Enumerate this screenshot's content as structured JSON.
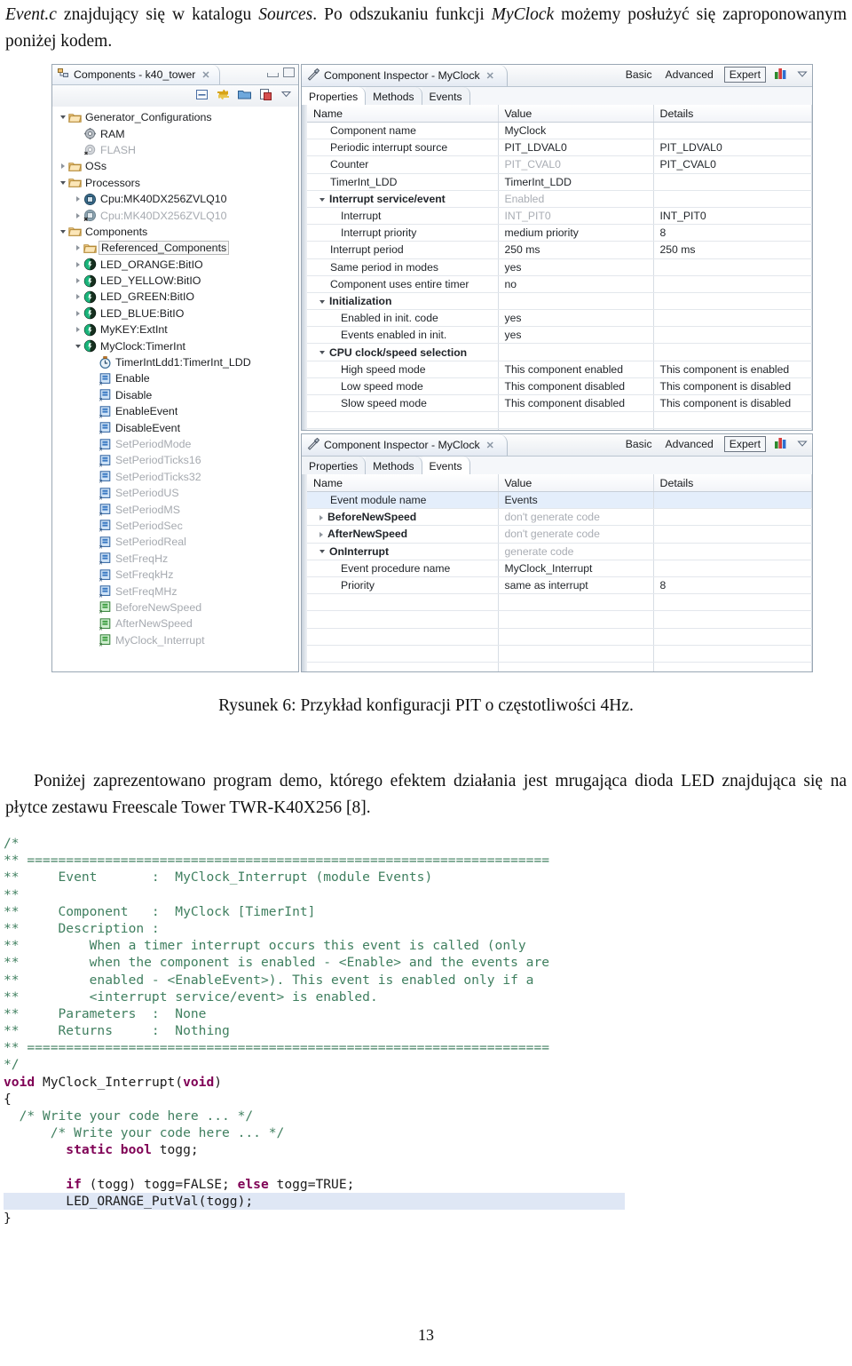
{
  "document": {
    "intro_paragraph": [
      {
        "t": "Event.c",
        "i": true
      },
      {
        "t": " znajdujący się w katalogu ",
        "i": false
      },
      {
        "t": "Sources",
        "i": true
      },
      {
        "t": ". Po odszukaniu funkcji ",
        "i": false
      },
      {
        "t": "MyClock",
        "i": true
      },
      {
        "t": " możemy posłużyć się zaproponowanym poniżej kodem.",
        "i": false
      }
    ],
    "figure_caption": "Rysunek 6: Przykład konfiguracji PIT o częstotliwości 4Hz.",
    "demo_paragraph": "Poniżej zaprezentowano program demo, którego efektem działania jest mrugająca dioda LED znajdująca się na płytce zestawu Freescale Tower TWR-K40X256 [8].",
    "page_number": "13"
  },
  "components_view": {
    "tab_title": "Components - k40_tower",
    "tab_icon": "components-icon",
    "close_label": "✕",
    "window_buttons": [
      "minimize",
      "maximize"
    ],
    "toolbar_icons": [
      "collapse-all-icon",
      "refresh-sync-icon",
      "folder-icon",
      "export-icon",
      "view-menu-chevron-icon"
    ],
    "tree": [
      {
        "label": "Generator_Configurations",
        "indent": 0,
        "arrow": "expanded",
        "icon": "folder-icon",
        "dim": false
      },
      {
        "label": "RAM",
        "indent": 1,
        "arrow": "none",
        "icon": "gear-icon",
        "dim": false
      },
      {
        "label": "FLASH",
        "indent": 1,
        "arrow": "none",
        "icon": "gear-disabled-icon",
        "dim": true
      },
      {
        "label": "OSs",
        "indent": 0,
        "arrow": "collapsed",
        "icon": "folder-icon",
        "dim": false
      },
      {
        "label": "Processors",
        "indent": 0,
        "arrow": "expanded",
        "icon": "folder-icon",
        "dim": false
      },
      {
        "label": "Cpu:MK40DX256ZVLQ10",
        "indent": 1,
        "arrow": "collapsed",
        "icon": "cpu-icon",
        "dim": false
      },
      {
        "label": "Cpu:MK40DX256ZVLQ10",
        "indent": 1,
        "arrow": "collapsed",
        "icon": "cpu-disabled-icon",
        "dim": true
      },
      {
        "label": "Components",
        "indent": 0,
        "arrow": "expanded",
        "icon": "folder-icon",
        "dim": false
      },
      {
        "label": "Referenced_Components",
        "indent": 1,
        "arrow": "collapsed",
        "icon": "folder-icon",
        "dim": false,
        "boxed": true
      },
      {
        "label": "LED_ORANGE:BitIO",
        "indent": 1,
        "arrow": "collapsed",
        "icon": "component-icon",
        "dim": false
      },
      {
        "label": "LED_YELLOW:BitIO",
        "indent": 1,
        "arrow": "collapsed",
        "icon": "component-icon",
        "dim": false
      },
      {
        "label": "LED_GREEN:BitIO",
        "indent": 1,
        "arrow": "collapsed",
        "icon": "component-icon",
        "dim": false
      },
      {
        "label": "LED_BLUE:BitIO",
        "indent": 1,
        "arrow": "collapsed",
        "icon": "component-icon",
        "dim": false
      },
      {
        "label": "MyKEY:ExtInt",
        "indent": 1,
        "arrow": "collapsed",
        "icon": "component-icon",
        "dim": false
      },
      {
        "label": "MyClock:TimerInt",
        "indent": 1,
        "arrow": "expanded",
        "icon": "component-icon",
        "dim": false
      },
      {
        "label": "TimerIntLdd1:TimerInt_LDD",
        "indent": 2,
        "arrow": "none",
        "icon": "timer-icon",
        "dim": false
      },
      {
        "label": "Enable",
        "indent": 2,
        "arrow": "none",
        "icon": "method-icon",
        "dim": false
      },
      {
        "label": "Disable",
        "indent": 2,
        "arrow": "none",
        "icon": "method-icon",
        "dim": false
      },
      {
        "label": "EnableEvent",
        "indent": 2,
        "arrow": "none",
        "icon": "method-icon",
        "dim": false
      },
      {
        "label": "DisableEvent",
        "indent": 2,
        "arrow": "none",
        "icon": "method-icon",
        "dim": false
      },
      {
        "label": "SetPeriodMode",
        "indent": 2,
        "arrow": "none",
        "icon": "method-icon",
        "dim": true
      },
      {
        "label": "SetPeriodTicks16",
        "indent": 2,
        "arrow": "none",
        "icon": "method-icon",
        "dim": true
      },
      {
        "label": "SetPeriodTicks32",
        "indent": 2,
        "arrow": "none",
        "icon": "method-icon",
        "dim": true
      },
      {
        "label": "SetPeriodUS",
        "indent": 2,
        "arrow": "none",
        "icon": "method-icon",
        "dim": true
      },
      {
        "label": "SetPeriodMS",
        "indent": 2,
        "arrow": "none",
        "icon": "method-icon",
        "dim": true
      },
      {
        "label": "SetPeriodSec",
        "indent": 2,
        "arrow": "none",
        "icon": "method-icon",
        "dim": true
      },
      {
        "label": "SetPeriodReal",
        "indent": 2,
        "arrow": "none",
        "icon": "method-icon",
        "dim": true
      },
      {
        "label": "SetFreqHz",
        "indent": 2,
        "arrow": "none",
        "icon": "method-icon",
        "dim": true
      },
      {
        "label": "SetFreqkHz",
        "indent": 2,
        "arrow": "none",
        "icon": "method-icon",
        "dim": true
      },
      {
        "label": "SetFreqMHz",
        "indent": 2,
        "arrow": "none",
        "icon": "method-icon",
        "dim": true
      },
      {
        "label": "BeforeNewSpeed",
        "indent": 2,
        "arrow": "none",
        "icon": "event-icon",
        "dim": true
      },
      {
        "label": "AfterNewSpeed",
        "indent": 2,
        "arrow": "none",
        "icon": "event-icon",
        "dim": true
      },
      {
        "label": "MyClock_Interrupt",
        "indent": 2,
        "arrow": "none",
        "icon": "event-icon",
        "dim": true
      }
    ]
  },
  "inspector_properties": {
    "tab_title": "Component Inspector - MyClock",
    "tab_icon": "inspector-icon",
    "close_label": "✕",
    "modes": [
      "Basic",
      "Advanced",
      "Expert"
    ],
    "active_mode": "Expert",
    "chart_icon": "bar-chart-icon",
    "menu_icon": "view-menu-chevron-icon",
    "sub_tabs": [
      "Properties",
      "Methods",
      "Events"
    ],
    "active_sub_tab": "Properties",
    "columns": [
      "Name",
      "Value",
      "Details"
    ],
    "rows": [
      {
        "name": "Component name",
        "level": 1,
        "group": false,
        "arrow": "none",
        "value": "MyClock",
        "value_gray": false,
        "details": ""
      },
      {
        "name": "Periodic interrupt source",
        "level": 1,
        "group": false,
        "arrow": "none",
        "value": "PIT_LDVAL0",
        "value_gray": false,
        "details": "PIT_LDVAL0"
      },
      {
        "name": "Counter",
        "level": 1,
        "group": false,
        "arrow": "none",
        "value": "PIT_CVAL0",
        "value_gray": true,
        "details": "PIT_CVAL0"
      },
      {
        "name": "TimerInt_LDD",
        "level": 1,
        "group": false,
        "arrow": "none",
        "value": "TimerInt_LDD",
        "value_gray": false,
        "details": ""
      },
      {
        "name": "Interrupt service/event",
        "level": 0,
        "group": true,
        "arrow": "expanded",
        "value": "Enabled",
        "value_gray": true,
        "details": ""
      },
      {
        "name": "Interrupt",
        "level": 2,
        "group": false,
        "arrow": "none",
        "value": "INT_PIT0",
        "value_gray": true,
        "details": "INT_PIT0"
      },
      {
        "name": "Interrupt priority",
        "level": 2,
        "group": false,
        "arrow": "none",
        "value": "medium priority",
        "value_gray": false,
        "details": "8"
      },
      {
        "name": "Interrupt period",
        "level": 1,
        "group": false,
        "arrow": "none",
        "value": "250 ms",
        "value_gray": false,
        "details": "250 ms"
      },
      {
        "name": "Same period in modes",
        "level": 1,
        "group": false,
        "arrow": "none",
        "value": "yes",
        "value_gray": false,
        "details": ""
      },
      {
        "name": "Component uses entire timer",
        "level": 1,
        "group": false,
        "arrow": "none",
        "value": "no",
        "value_gray": false,
        "details": ""
      },
      {
        "name": "Initialization",
        "level": 0,
        "group": true,
        "arrow": "expanded",
        "value": "",
        "value_gray": false,
        "details": ""
      },
      {
        "name": "Enabled in init. code",
        "level": 2,
        "group": false,
        "arrow": "none",
        "value": "yes",
        "value_gray": false,
        "details": ""
      },
      {
        "name": "Events enabled in init.",
        "level": 2,
        "group": false,
        "arrow": "none",
        "value": "yes",
        "value_gray": false,
        "details": ""
      },
      {
        "name": "CPU clock/speed selection",
        "level": 0,
        "group": true,
        "arrow": "expanded",
        "value": "",
        "value_gray": false,
        "details": ""
      },
      {
        "name": "High speed mode",
        "level": 2,
        "group": false,
        "arrow": "none",
        "value": "This component enabled",
        "value_gray": false,
        "details": "This component is enabled"
      },
      {
        "name": "Low speed mode",
        "level": 2,
        "group": false,
        "arrow": "none",
        "value": "This component disabled",
        "value_gray": false,
        "details": "This component is disabled"
      },
      {
        "name": "Slow speed mode",
        "level": 2,
        "group": false,
        "arrow": "none",
        "value": "This component disabled",
        "value_gray": false,
        "details": "This component is disabled"
      },
      {
        "name": "",
        "level": 1,
        "group": false,
        "arrow": "none",
        "value": "",
        "value_gray": false,
        "details": ""
      },
      {
        "name": "",
        "level": 1,
        "group": false,
        "arrow": "none",
        "value": "",
        "value_gray": false,
        "details": ""
      }
    ]
  },
  "inspector_events": {
    "tab_title": "Component Inspector - MyClock",
    "tab_icon": "inspector-icon",
    "close_label": "✕",
    "modes": [
      "Basic",
      "Advanced",
      "Expert"
    ],
    "active_mode": "Expert",
    "chart_icon": "bar-chart-icon",
    "menu_icon": "view-menu-chevron-icon",
    "sub_tabs": [
      "Properties",
      "Methods",
      "Events"
    ],
    "active_sub_tab": "Events",
    "columns": [
      "Name",
      "Value",
      "Details"
    ],
    "rows": [
      {
        "name": "Event module name",
        "level": 1,
        "group": false,
        "arrow": "none",
        "value": "Events",
        "value_gray": false,
        "details": "",
        "selected": true
      },
      {
        "name": "BeforeNewSpeed",
        "level": 0,
        "group": true,
        "arrow": "collapsed",
        "value": "don't generate code",
        "value_gray": true,
        "details": "",
        "selected": false
      },
      {
        "name": "AfterNewSpeed",
        "level": 0,
        "group": true,
        "arrow": "collapsed",
        "value": "don't generate code",
        "value_gray": true,
        "details": "",
        "selected": false
      },
      {
        "name": "OnInterrupt",
        "level": 0,
        "group": true,
        "arrow": "expanded",
        "value": "generate code",
        "value_gray": true,
        "details": "",
        "selected": false
      },
      {
        "name": "Event procedure name",
        "level": 2,
        "group": false,
        "arrow": "none",
        "value": "MyClock_Interrupt",
        "value_gray": false,
        "details": "",
        "selected": false
      },
      {
        "name": "Priority",
        "level": 2,
        "group": false,
        "arrow": "none",
        "value": "same as interrupt",
        "value_gray": false,
        "details": "8",
        "selected": false
      },
      {
        "name": "",
        "level": 1,
        "group": false,
        "arrow": "none",
        "value": "",
        "value_gray": false,
        "details": "",
        "selected": false
      },
      {
        "name": "",
        "level": 1,
        "group": false,
        "arrow": "none",
        "value": "",
        "value_gray": false,
        "details": "",
        "selected": false
      },
      {
        "name": "",
        "level": 1,
        "group": false,
        "arrow": "none",
        "value": "",
        "value_gray": false,
        "details": "",
        "selected": false
      },
      {
        "name": "",
        "level": 1,
        "group": false,
        "arrow": "none",
        "value": "",
        "value_gray": false,
        "details": "",
        "selected": false
      },
      {
        "name": "",
        "level": 1,
        "group": false,
        "arrow": "none",
        "value": "",
        "value_gray": false,
        "details": "",
        "selected": false
      }
    ]
  },
  "code_listing": {
    "language": "c",
    "lines": [
      [
        {
          "t": "/*",
          "c": "cm"
        }
      ],
      [
        {
          "t": "** ===================================================================",
          "c": "cm"
        }
      ],
      [
        {
          "t": "**     Event       :  MyClock_Interrupt (module Events)",
          "c": "cm"
        }
      ],
      [
        {
          "t": "**",
          "c": "cm"
        }
      ],
      [
        {
          "t": "**     Component   :  MyClock [TimerInt]",
          "c": "cm"
        }
      ],
      [
        {
          "t": "**     Description :",
          "c": "cm"
        }
      ],
      [
        {
          "t": "**         When a timer interrupt occurs this event is called (only",
          "c": "cm"
        }
      ],
      [
        {
          "t": "**         when the component is enabled - <Enable> and the events are",
          "c": "cm"
        }
      ],
      [
        {
          "t": "**         enabled - <EnableEvent>). This event is enabled only if a",
          "c": "cm"
        }
      ],
      [
        {
          "t": "**         <interrupt service/event> is enabled.",
          "c": "cm"
        }
      ],
      [
        {
          "t": "**     Parameters  :  None",
          "c": "cm"
        }
      ],
      [
        {
          "t": "**     Returns     :  Nothing",
          "c": "cm"
        }
      ],
      [
        {
          "t": "** ===================================================================",
          "c": "cm"
        }
      ],
      [
        {
          "t": "*/",
          "c": "cm"
        }
      ],
      [
        {
          "t": "void",
          "c": "kw"
        },
        {
          "t": " MyClock_Interrupt(",
          "c": "id"
        },
        {
          "t": "void",
          "c": "kw"
        },
        {
          "t": ")",
          "c": "id"
        }
      ],
      [
        {
          "t": "{",
          "c": "id"
        }
      ],
      [
        {
          "t": "  /* Write your code here ... */",
          "c": "cm"
        }
      ],
      [
        {
          "t": "      /* Write your code here ... */",
          "c": "cm"
        }
      ],
      [
        {
          "t": "        ",
          "c": "id"
        },
        {
          "t": "static bool",
          "c": "kw"
        },
        {
          "t": " togg;",
          "c": "id"
        }
      ],
      [
        {
          "t": "",
          "c": "id"
        }
      ],
      [
        {
          "t": "        ",
          "c": "id"
        },
        {
          "t": "if",
          "c": "kw"
        },
        {
          "t": " (togg) togg=FALSE; ",
          "c": "id"
        },
        {
          "t": "else",
          "c": "kw"
        },
        {
          "t": " togg=TRUE;",
          "c": "id"
        }
      ],
      [
        {
          "t": "        LED_ORANGE_PutVal(togg);",
          "c": "id",
          "hl": true
        }
      ],
      [
        {
          "t": "}",
          "c": "id"
        }
      ]
    ],
    "highlighted_line_index": 21
  }
}
